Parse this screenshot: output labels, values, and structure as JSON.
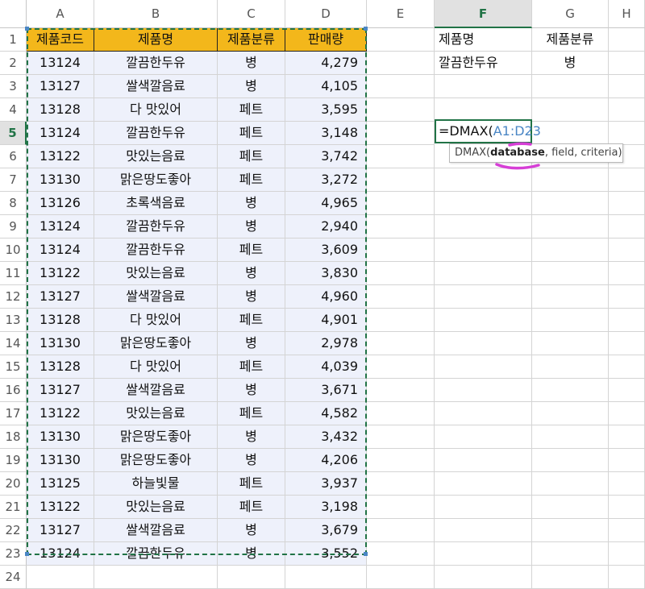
{
  "columns": [
    "",
    "A",
    "B",
    "C",
    "D",
    "E",
    "F",
    "G",
    "H"
  ],
  "row_numbers": [
    "1",
    "2",
    "3",
    "4",
    "5",
    "6",
    "7",
    "8",
    "9",
    "10",
    "11",
    "12",
    "13",
    "14",
    "15",
    "16",
    "17",
    "18",
    "19",
    "20",
    "21",
    "22",
    "23",
    "24"
  ],
  "header": [
    "제품코드",
    "제품명",
    "제품분류",
    "판매량"
  ],
  "rows": [
    [
      "13124",
      "깔끔한두유",
      "병",
      "4,279"
    ],
    [
      "13127",
      "쌀색깔음료",
      "병",
      "4,105"
    ],
    [
      "13128",
      "다 맛있어",
      "페트",
      "3,595"
    ],
    [
      "13124",
      "깔끔한두유",
      "페트",
      "3,148"
    ],
    [
      "13122",
      "맛있는음료",
      "페트",
      "3,742"
    ],
    [
      "13130",
      "맑은땅도좋아",
      "페트",
      "3,272"
    ],
    [
      "13126",
      "초록색음료",
      "병",
      "4,965"
    ],
    [
      "13124",
      "깔끔한두유",
      "병",
      "2,940"
    ],
    [
      "13124",
      "깔끔한두유",
      "페트",
      "3,609"
    ],
    [
      "13122",
      "맛있는음료",
      "병",
      "3,830"
    ],
    [
      "13127",
      "쌀색깔음료",
      "병",
      "4,960"
    ],
    [
      "13128",
      "다 맛있어",
      "페트",
      "4,901"
    ],
    [
      "13130",
      "맑은땅도좋아",
      "병",
      "2,978"
    ],
    [
      "13128",
      "다 맛있어",
      "페트",
      "4,039"
    ],
    [
      "13127",
      "쌀색깔음료",
      "병",
      "3,671"
    ],
    [
      "13122",
      "맛있는음료",
      "페트",
      "4,582"
    ],
    [
      "13130",
      "맑은땅도좋아",
      "병",
      "3,432"
    ],
    [
      "13130",
      "맑은땅도좋아",
      "병",
      "4,206"
    ],
    [
      "13125",
      "하늘빛물",
      "페트",
      "3,937"
    ],
    [
      "13122",
      "맛있는음료",
      "페트",
      "3,198"
    ],
    [
      "13127",
      "쌀색깔음료",
      "병",
      "3,679"
    ],
    [
      "13124",
      "깔끔한두유",
      "병",
      "3,552"
    ]
  ],
  "criteria": {
    "f1": "제품명",
    "g1": "제품분류",
    "f2": "깔끔한두유",
    "g2": "병"
  },
  "formula": {
    "prefix": "=DMAX(",
    "ref_a": "A1",
    "colon": ":",
    "ref_b": "D23"
  },
  "tooltip": {
    "func": "DMAX(",
    "arg_bold": "database",
    "rest": ", field, criteria)"
  },
  "colors": {
    "header_fill": "#f3b71b",
    "database_fill": "#eef1fb",
    "selection_green": "#217346",
    "reference_blue": "#4a86c5",
    "annotation_magenta": "#d63fd6"
  }
}
